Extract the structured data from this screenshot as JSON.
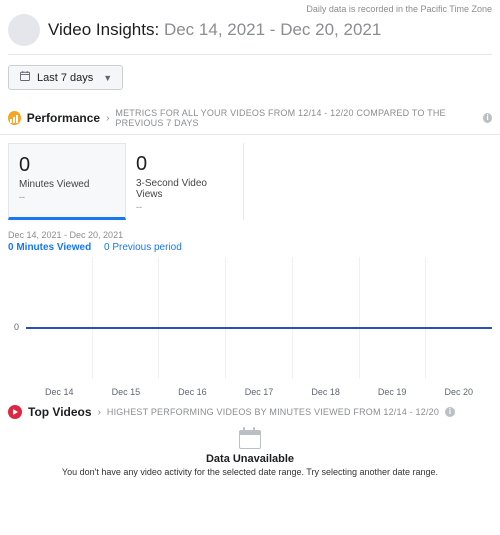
{
  "notices": {
    "timezone": "Daily data is recorded in the Pacific Time Zone"
  },
  "header": {
    "title_prefix": "Video Insights:",
    "date_range": "Dec 14, 2021 - Dec 20, 2021"
  },
  "range_selector": {
    "label": "Last 7 days"
  },
  "performance": {
    "title": "Performance",
    "subtitle": "METRICS FOR ALL YOUR VIDEOS FROM 12/14 - 12/20 COMPARED TO THE PREVIOUS 7 DAYS",
    "cards": [
      {
        "value": "0",
        "label": "Minutes Viewed",
        "delta": "--",
        "selected": true
      },
      {
        "value": "0",
        "label": "3-Second Video Views",
        "delta": "--",
        "selected": false
      }
    ]
  },
  "chart_data": {
    "type": "line",
    "title": "",
    "date_range_label": "Dec 14, 2021 - Dec 20, 2021",
    "legend": {
      "metric_value": "0",
      "metric_label": "Minutes Viewed",
      "compare_value": "0",
      "compare_label": "Previous period"
    },
    "categories": [
      "Dec 14",
      "Dec 15",
      "Dec 16",
      "Dec 17",
      "Dec 18",
      "Dec 19",
      "Dec 20"
    ],
    "series": [
      {
        "name": "Minutes Viewed",
        "values": [
          0,
          0,
          0,
          0,
          0,
          0,
          0
        ],
        "color": "#2b4eb8"
      },
      {
        "name": "Previous period",
        "values": [
          0,
          0,
          0,
          0,
          0,
          0,
          0
        ],
        "color": "#9db4e6"
      }
    ],
    "xlabel": "",
    "ylabel": "",
    "ylim": [
      0,
      1
    ],
    "yticks": [
      0
    ]
  },
  "top_videos": {
    "title": "Top Videos",
    "subtitle": "HIGHEST PERFORMING VIDEOS BY MINUTES VIEWED FROM 12/14 - 12/20",
    "empty_title": "Data Unavailable",
    "empty_msg": "You don't have any video activity for the selected date range. Try selecting another date range."
  }
}
